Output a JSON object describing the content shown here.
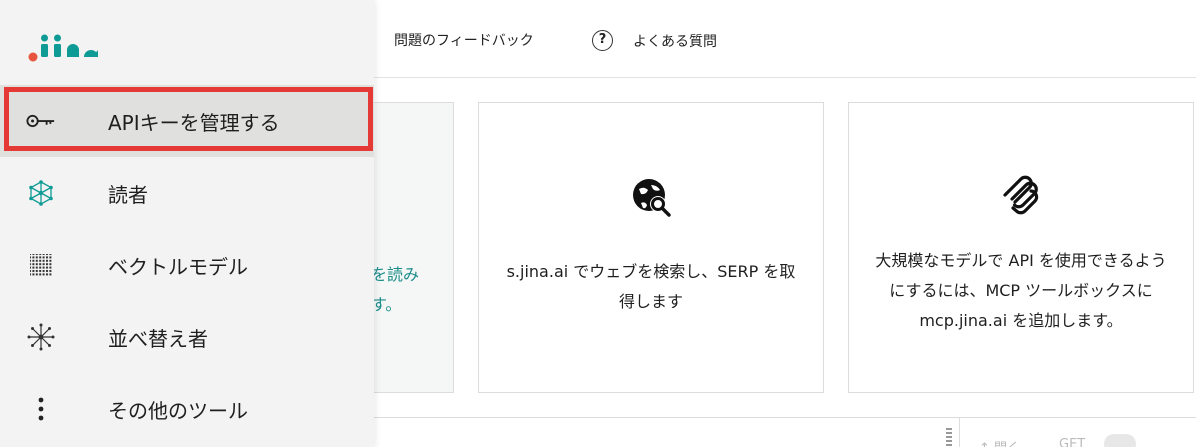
{
  "topbar": {
    "feedback_label": "問題のフィードバック",
    "faq_label": "よくある質問",
    "faq_icon": "?"
  },
  "cards": {
    "partial": {
      "text": "を読み す。"
    },
    "serp": {
      "icon": "globe-search-icon",
      "desc": "s.jina.ai でウェブを検索し、SERP を取得します"
    },
    "mcp": {
      "icon": "mcp-icon",
      "desc": "大規模なモデルで API を使用できるようにするには、MCP ツールボックスに mcp.jina.ai を追加します。"
    }
  },
  "bottom": {
    "open_label": "↑ 開く",
    "get_label": "GET"
  },
  "drawer": {
    "logo_text": "jina",
    "items": [
      {
        "label": "APIキーを管理する",
        "icon": "key-icon",
        "active": true
      },
      {
        "label": "読者",
        "icon": "reader-icon",
        "active": false
      },
      {
        "label": "ベクトルモデル",
        "icon": "embeddings-icon",
        "active": false
      },
      {
        "label": "並べ替え者",
        "icon": "reranker-icon",
        "active": false
      },
      {
        "label": "その他のツール",
        "icon": "more-vertical-icon",
        "active": false
      }
    ]
  },
  "colors": {
    "accent_teal": "#1a8d8a",
    "highlight_red": "#e53935",
    "logo_red": "#e8553f",
    "logo_teal": "#0f9b95"
  }
}
